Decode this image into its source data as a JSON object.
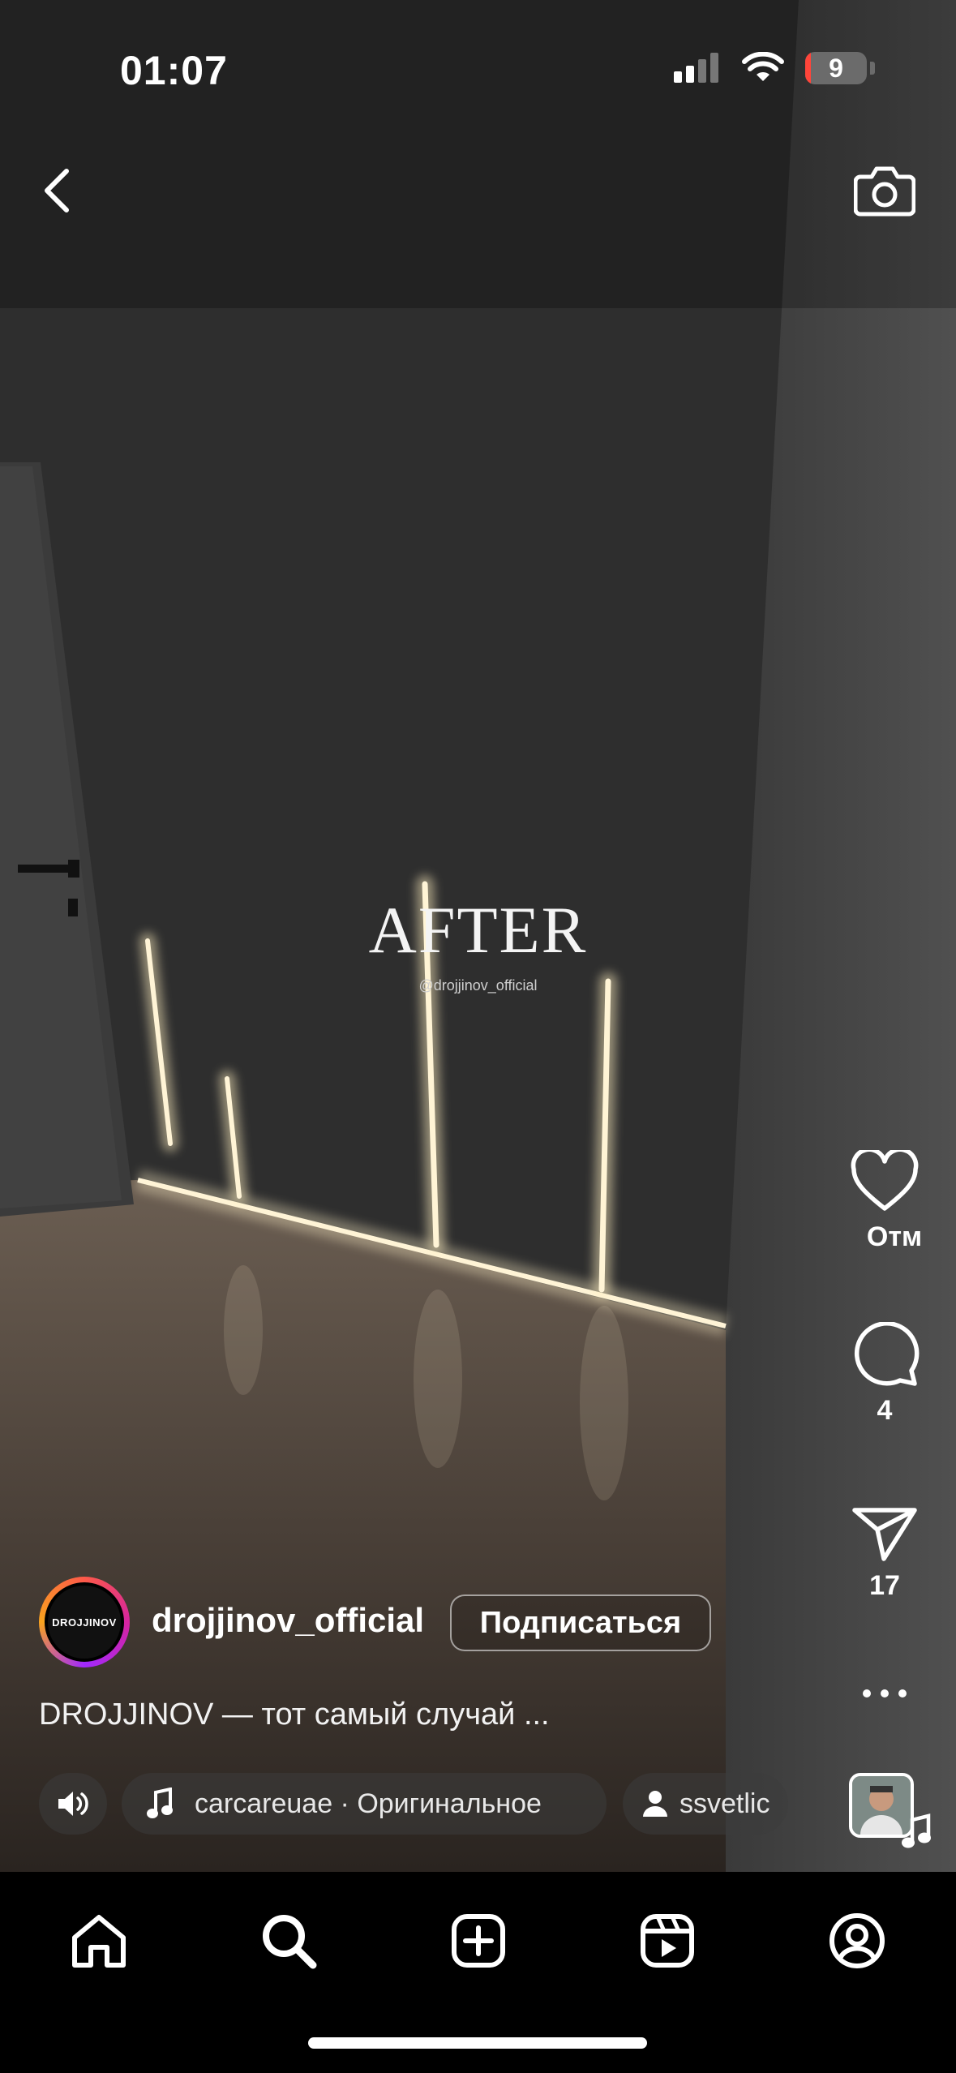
{
  "status_bar": {
    "time": "01:07",
    "battery_level": "9"
  },
  "overlay": {
    "title": "AFTER",
    "watermark": "@drojjinov_official"
  },
  "rail": {
    "like_label": "Отм",
    "comments_count": "4",
    "shares_count": "17"
  },
  "author": {
    "avatar_text": "DROJJINOV",
    "username": "drojjinov_official",
    "follow_label": "Подписаться"
  },
  "caption": "DROJJINOV — тот самый случай ...",
  "audio": {
    "track": "carcareuae · Оригинальное",
    "tagged_user": "ssvetlic"
  },
  "nav": {
    "items": [
      "home-icon",
      "search-icon",
      "create-icon",
      "reels-icon",
      "profile-icon"
    ]
  },
  "colors": {
    "background": "#000000",
    "battery_low": "#ff453a",
    "accent_ring": [
      "#fd5949",
      "#d6249f",
      "#f9a31e"
    ]
  }
}
